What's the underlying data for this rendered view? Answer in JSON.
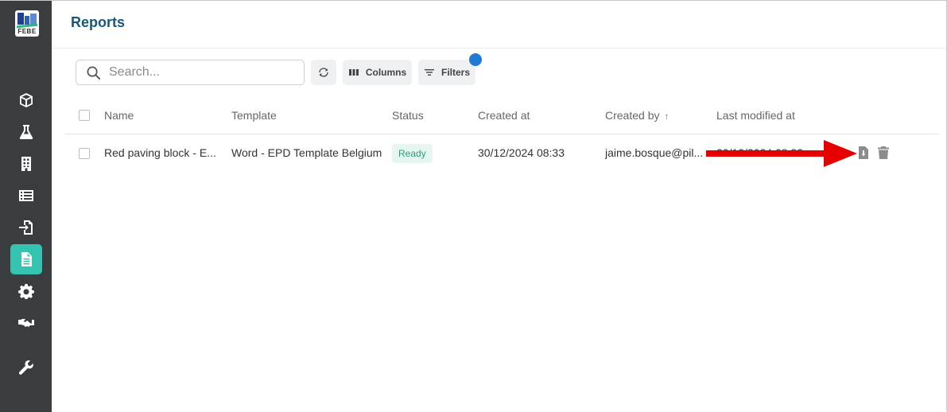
{
  "sidebar": {
    "logo_text": "FEBE",
    "items": [
      {
        "icon": "box-icon"
      },
      {
        "icon": "flask-icon"
      },
      {
        "icon": "building-icon"
      },
      {
        "icon": "list-icon"
      },
      {
        "icon": "file-import-icon"
      },
      {
        "icon": "file-text-icon",
        "active": true
      },
      {
        "icon": "gear-icon"
      },
      {
        "icon": "handshake-icon"
      },
      {
        "icon": "wrench-icon"
      }
    ]
  },
  "header": {
    "title": "Reports"
  },
  "toolbar": {
    "search_placeholder": "Search...",
    "columns_label": "Columns",
    "filters_label": "Filters"
  },
  "table": {
    "columns": {
      "name": "Name",
      "template": "Template",
      "status": "Status",
      "created_at": "Created at",
      "created_by": "Created by",
      "created_by_sort": "↑",
      "last_modified_at": "Last modified at"
    },
    "rows": [
      {
        "name": "Red paving block - E...",
        "template": "Word - EPD Template Belgium",
        "status": "Ready",
        "created_at": "30/12/2024 08:33",
        "created_by": "jaime.bosque@pil...",
        "last_modified_at": "30/12/2024 08:33"
      }
    ]
  },
  "colors": {
    "sidebar": "#3a3d40",
    "active": "#33c3b0",
    "title": "#17587a",
    "filter_dot": "#1f7ad6",
    "annotation_arrow": "#e60000"
  }
}
